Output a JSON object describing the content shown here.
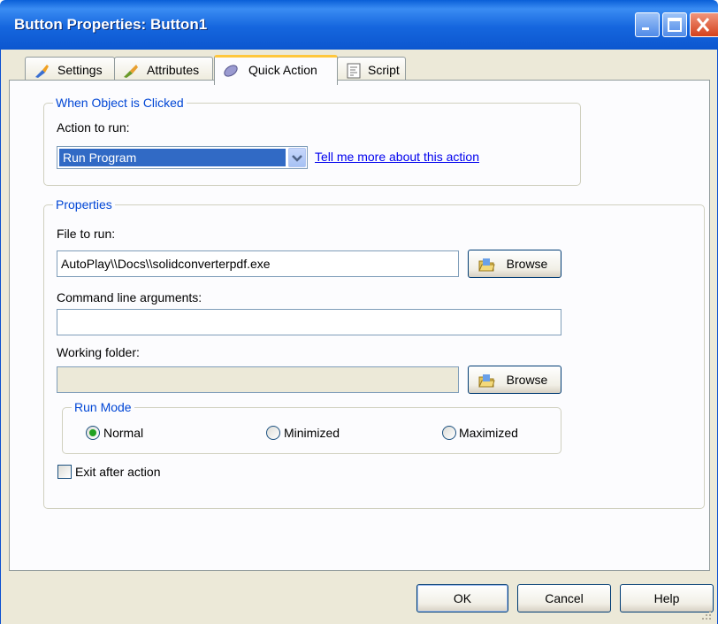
{
  "window": {
    "title": "Button Properties: Button1"
  },
  "tabs": [
    {
      "label": "Settings",
      "icon": "paintbrush-icon"
    },
    {
      "label": "Attributes",
      "icon": "brush-icon"
    },
    {
      "label": "Quick Action",
      "icon": "lozenge-icon",
      "active": true
    },
    {
      "label": "Script",
      "icon": "script-icon"
    }
  ],
  "click_group": {
    "title": "When Object is Clicked",
    "action_label": "Action to run:",
    "action_value": "Run Program",
    "help_link": "Tell me more about this action"
  },
  "properties": {
    "title": "Properties",
    "file_label": "File to run:",
    "file_value": "AutoPlay\\\\Docs\\\\solidconverterpdf.exe",
    "args_label": "Command line arguments:",
    "args_value": "",
    "folder_label": "Working folder:",
    "folder_value": "",
    "browse_label": "Browse",
    "run_mode": {
      "title": "Run Mode",
      "options": [
        "Normal",
        "Minimized",
        "Maximized"
      ],
      "selected": "Normal"
    },
    "exit_label": "Exit after action",
    "exit_checked": false
  },
  "footer": {
    "ok": "OK",
    "cancel": "Cancel",
    "help": "Help"
  },
  "colors": {
    "titlebar": "#0a5fd8",
    "group_title": "#0046d5",
    "selection": "#316ac5",
    "link": "#0000ee"
  }
}
